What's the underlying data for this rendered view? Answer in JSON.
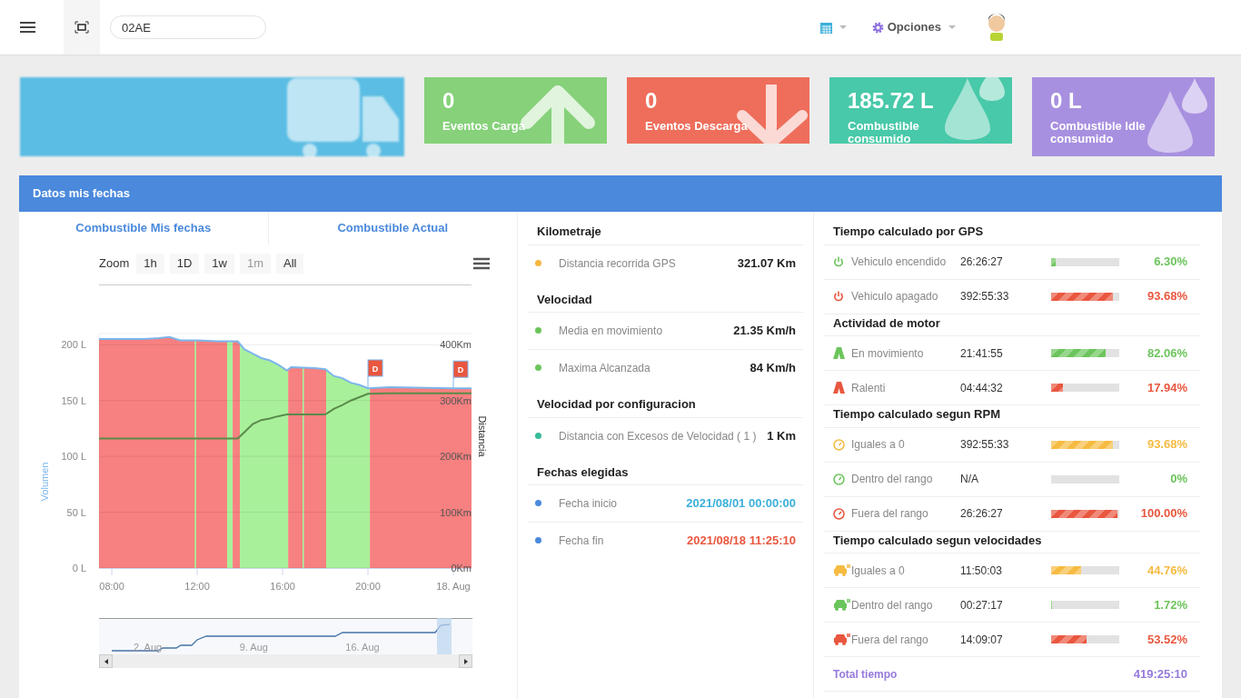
{
  "topbar": {
    "search": {
      "value": "02AE"
    },
    "options_label": "Opciones"
  },
  "cards": [
    {
      "kind": "vehicle",
      "color": "#5bbde3"
    },
    {
      "kind": "up",
      "value": "0",
      "label": "Eventos Carga",
      "color": "#86d17a"
    },
    {
      "kind": "down",
      "value": "0",
      "label": "Eventos Descarga",
      "color": "#ee6e5b"
    },
    {
      "kind": "drop",
      "value": "185.72 L",
      "label": "Combustible consumido",
      "color": "#48c9a9"
    },
    {
      "kind": "drop",
      "value": "0 L",
      "label": "Combustible Idle consumido",
      "color": "#a890e0"
    }
  ],
  "panel": {
    "title": "Datos mis fechas",
    "tabs": [
      {
        "label": "Combustible Mis fechas"
      },
      {
        "label": "Combustible Actual"
      }
    ],
    "zoom": {
      "label": "Zoom",
      "buttons": [
        {
          "label": "1h",
          "disabled": false
        },
        {
          "label": "1D",
          "disabled": false
        },
        {
          "label": "1w",
          "disabled": false
        },
        {
          "label": "1m",
          "disabled": true
        },
        {
          "label": "All",
          "disabled": false
        }
      ]
    },
    "chart_data": {
      "type": "line",
      "grid": true,
      "xlim": [
        7.4,
        24.85
      ],
      "ylim": [
        0,
        210
      ],
      "y2lim": [
        0,
        420
      ],
      "xticks": [
        {
          "value": 8,
          "label": "08:00"
        },
        {
          "value": 12,
          "label": "12:00"
        },
        {
          "value": 16,
          "label": "16:00"
        },
        {
          "value": 20,
          "label": "20:00"
        },
        {
          "value": 24,
          "label": "18. Aug"
        }
      ],
      "yticks": [
        {
          "value": 0,
          "label": "0 L"
        },
        {
          "value": 50,
          "label": "50 L"
        },
        {
          "value": 100,
          "label": "100 L"
        },
        {
          "value": 150,
          "label": "150 L"
        },
        {
          "value": 200,
          "label": "200 L"
        }
      ],
      "y2ticks": [
        {
          "value": 0,
          "label": "0Km"
        },
        {
          "value": 100,
          "label": "100Km"
        },
        {
          "value": 200,
          "label": "200Km"
        },
        {
          "value": 300,
          "label": "300Km"
        },
        {
          "value": 400,
          "label": "400Km"
        }
      ],
      "x": [
        7.4,
        9.5,
        10.2,
        10.7,
        11.2,
        12,
        13,
        13.9,
        14.2,
        14.6,
        15,
        15.4,
        15.8,
        16.2,
        16.4,
        17.5,
        18,
        18.4,
        18.8,
        19.2,
        19.6,
        20,
        21,
        24,
        24.85
      ],
      "series": [
        {
          "name": "Volumen",
          "color": "#7cb5ec",
          "values": [
            205,
            205,
            206,
            207,
            204,
            204,
            203,
            203,
            196,
            192,
            188,
            186,
            182,
            177,
            180,
            179,
            178,
            172,
            170,
            166,
            164,
            161,
            162,
            161,
            161
          ]
        },
        {
          "name": "Distancia",
          "color": "#5a8a4a",
          "axis": "y2",
          "values": [
            232,
            232,
            232,
            232,
            232,
            232,
            232,
            232,
            243,
            258,
            265,
            268,
            272,
            275,
            275,
            275,
            275,
            285,
            292,
            300,
            306,
            312,
            313,
            313,
            313
          ]
        }
      ],
      "bands": [
        {
          "axis": "x",
          "from": 7.4,
          "to": 13.4,
          "color": "#f78080"
        },
        {
          "axis": "x",
          "from": 13.4,
          "to": 13.66,
          "color": "#a9f09a"
        },
        {
          "axis": "x",
          "from": 13.66,
          "to": 14.0,
          "color": "#f78080"
        },
        {
          "axis": "x",
          "from": 14.0,
          "to": 16.26,
          "color": "#a9f09a"
        },
        {
          "axis": "x",
          "from": 16.26,
          "to": 18.04,
          "color": "#f78080"
        },
        {
          "axis": "x",
          "from": 18.04,
          "to": 20.09,
          "color": "#a9f09a"
        },
        {
          "axis": "x",
          "from": 20.09,
          "to": 24.85,
          "color": "#f78080"
        },
        {
          "axis": "x",
          "from": 11.88,
          "to": 11.95,
          "color": "#a9f09a"
        },
        {
          "axis": "x",
          "from": 16.93,
          "to": 17.0,
          "color": "#a9f09a"
        }
      ],
      "annotations": [
        {
          "x": 20.0,
          "y": 162,
          "text": "D"
        },
        {
          "x": 24.0,
          "y": 161,
          "text": "D"
        }
      ]
    },
    "navigator": {
      "labels": [
        "2. Aug",
        "9. Aug",
        "16. Aug"
      ]
    },
    "stats": [
      {
        "title": "Kilometraje",
        "rows": [
          {
            "label": "Distancia recorrida GPS",
            "value": "321.07 Km",
            "color": "#f5b841",
            "kind": "plain"
          }
        ]
      },
      {
        "title": "Velocidad",
        "rows": [
          {
            "label": "Media en movimiento",
            "value": "21.35 Km/h",
            "color": "#6cc55c",
            "kind": "plain"
          },
          {
            "label": "Maxima Alcanzada",
            "value": "84 Km/h",
            "color": "#6cc55c",
            "kind": "plain"
          }
        ]
      },
      {
        "title": "Velocidad por configuracion",
        "rows": [
          {
            "label": "Distancia con Excesos de Velocidad ( 1 )",
            "value": "1 Km",
            "color": "#37bc9b",
            "kind": "plain"
          }
        ]
      },
      {
        "title": "Fechas elegidas",
        "rows": [
          {
            "label": "Fecha inicio",
            "value": "2021/08/01 00:00:00",
            "color": "#4a89dc",
            "kind": "start"
          },
          {
            "label": "Fecha fin",
            "value": "2021/08/18 11:25:10",
            "color": "#4a89dc",
            "kind": "end"
          }
        ]
      }
    ],
    "times": [
      {
        "title": "Tiempo calculado por GPS",
        "rows": [
          {
            "kind": "power",
            "label": "Vehiculo encendido",
            "time": "26:26:27",
            "level": 0.063,
            "percent": "6.30%",
            "color": "#6cc55c"
          },
          {
            "kind": "power",
            "label": "Vehiculo apagado",
            "time": "392:55:33",
            "level": 0.9368,
            "percent": "93.68%",
            "color": "#e9573f"
          }
        ]
      },
      {
        "title": "Actividad de motor",
        "rows": [
          {
            "kind": "road",
            "label": "En movimiento",
            "time": "21:41:55",
            "level": 0.8206,
            "percent": "82.06%",
            "color": "#6cc55c"
          },
          {
            "kind": "road",
            "label": "Ralenti",
            "time": "04:44:32",
            "level": 0.1794,
            "percent": "17.94%",
            "color": "#e9573f"
          }
        ]
      },
      {
        "title": "Tiempo calculado segun RPM",
        "rows": [
          {
            "kind": "gauge",
            "label": "Iguales a 0",
            "time": "392:55:33",
            "level": 0.9368,
            "percent": "93.68%",
            "color": "#f6bb42"
          },
          {
            "kind": "gauge",
            "label": "Dentro del rango",
            "time": "N/A",
            "level": 0,
            "percent": "0%",
            "color": "#6cc55c"
          },
          {
            "kind": "gauge",
            "label": "Fuera del rango",
            "time": "26:26:27",
            "level": 1,
            "percent": "100.00%",
            "color": "#e9573f"
          }
        ]
      },
      {
        "title": "Tiempo calculado segun velocidades",
        "rows": [
          {
            "kind": "car",
            "label": "Iguales a 0",
            "time": "11:50:03",
            "level": 0.4476,
            "percent": "44.76%",
            "color": "#f6bb42"
          },
          {
            "kind": "car",
            "label": "Dentro del rango",
            "time": "00:27:17",
            "level": 0.0172,
            "percent": "1.72%",
            "color": "#6cc55c"
          },
          {
            "kind": "car",
            "label": "Fuera del rango",
            "time": "14:09:07",
            "level": 0.5352,
            "percent": "53.52%",
            "color": "#e9573f"
          }
        ]
      }
    ],
    "total": {
      "label": "Total tiempo",
      "value": "419:25:10"
    }
  }
}
